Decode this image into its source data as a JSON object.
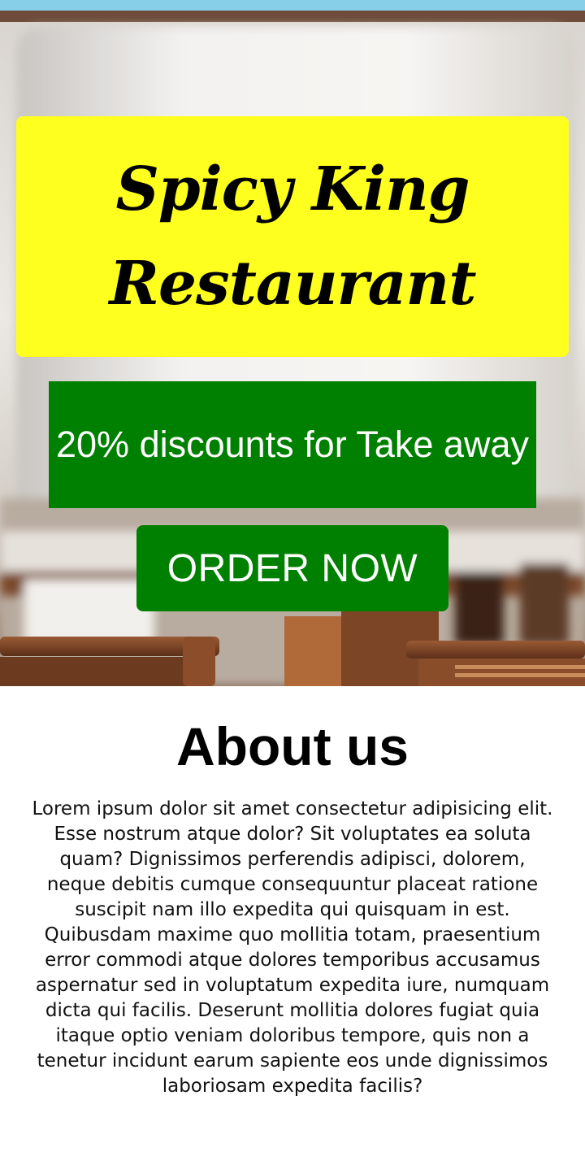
{
  "hero": {
    "title": "Spicy King Restaurant",
    "discount": "20% discounts for Take away",
    "order_button": "ORDER NOW"
  },
  "about": {
    "title": "About us",
    "body": "Lorem ipsum dolor sit amet consectetur adipisicing elit. Esse nostrum atque dolor? Sit voluptates ea soluta quam? Dignissimos perferendis adipisci, dolorem, neque debitis cumque consequuntur placeat ratione suscipit nam illo expedita qui quisquam in est. Quibusdam maxime quo mollitia totam, praesentium error commodi atque dolores temporibus accusamus aspernatur sed in voluptatum expedita iure, numquam dicta qui facilis. Deserunt mollitia dolores fugiat quia itaque optio veniam doloribus tempore, quis non a tenetur incidunt earum sapiente eos unde dignissimos laboriosam expedita facilis?"
  },
  "colors": {
    "status_bar": "#87cee9",
    "title_card": "#ffff1f",
    "discount_banner": "#008000",
    "order_button": "#008000"
  }
}
